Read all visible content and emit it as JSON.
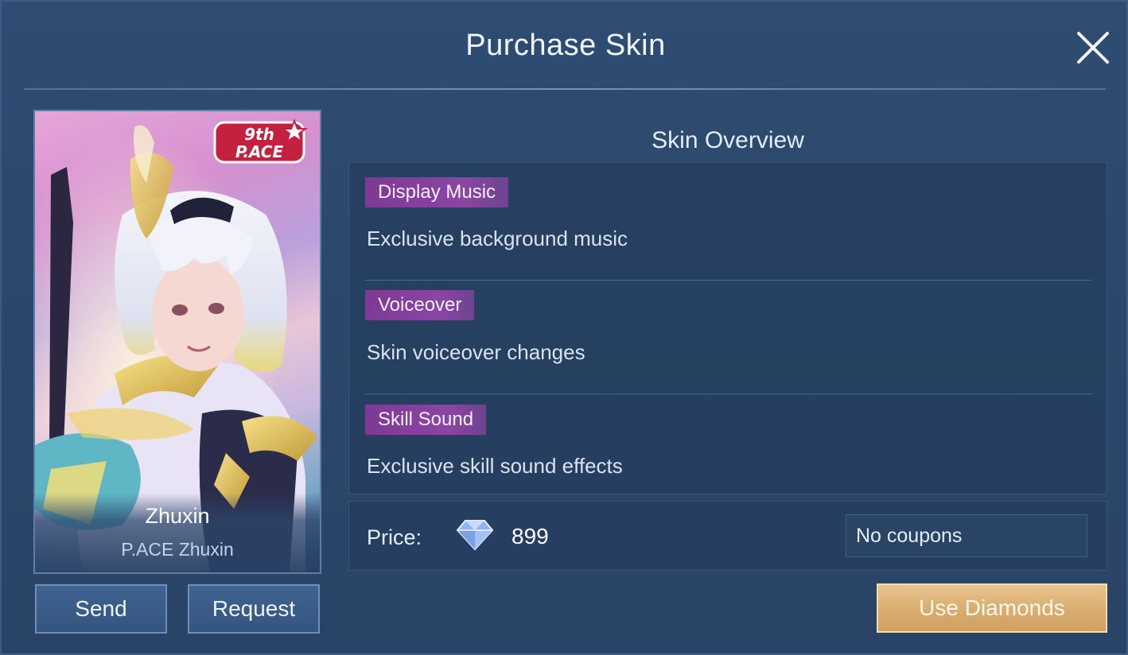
{
  "dialog": {
    "title": "Purchase Skin",
    "close_icon": "close-icon"
  },
  "card": {
    "hero_name": "Zhuxin",
    "skin_name": "P.ACE Zhuxin",
    "badge_line1": "9th",
    "badge_line2": "P.ACE",
    "send_label": "Send",
    "request_label": "Request"
  },
  "overview": {
    "title": "Skin Overview",
    "features": [
      {
        "tag": "Display Music",
        "desc": "Exclusive background music"
      },
      {
        "tag": "Voiceover",
        "desc": "Skin voiceover changes"
      },
      {
        "tag": "Skill Sound",
        "desc": "Exclusive skill sound effects"
      }
    ]
  },
  "price": {
    "label": "Price:",
    "currency_icon": "diamond-icon",
    "value": "899",
    "coupon": "No coupons"
  },
  "actions": {
    "use_diamonds_label": "Use Diamonds"
  },
  "colors": {
    "panel_bg": "#2b476b",
    "feature_tag": "#8b45a3",
    "primary_button": "#d9ae70"
  }
}
